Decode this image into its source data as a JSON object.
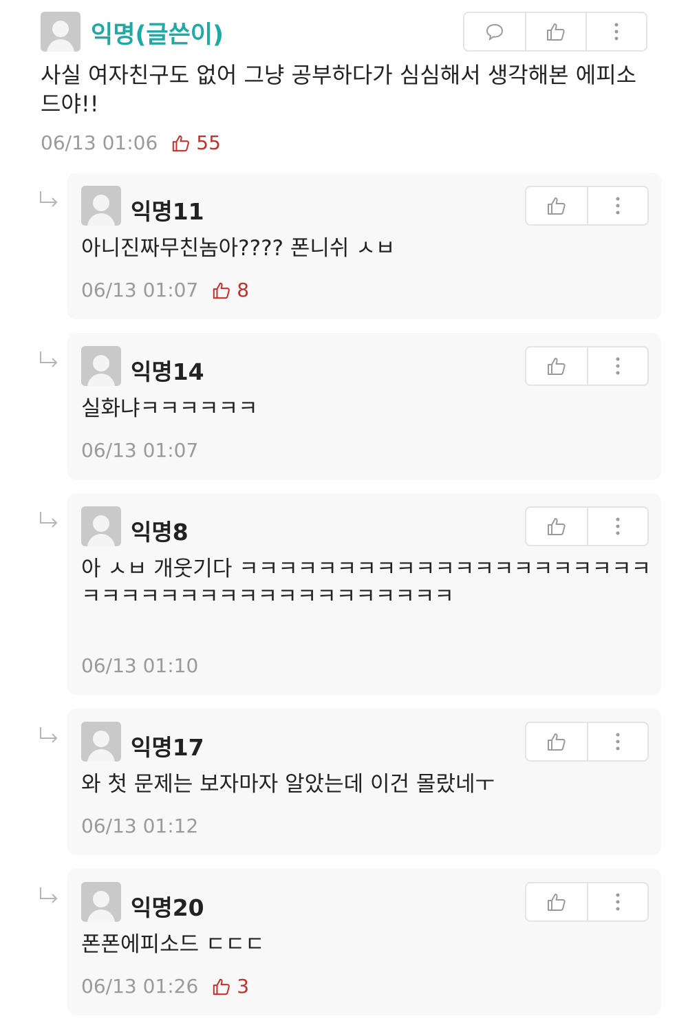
{
  "root": {
    "author": "익명(글쓴이)",
    "text": "사실 여자친구도 없어 그냥 공부하다가 심심해서 생각해본 에피소드야!!",
    "timestamp": "06/13 01:06",
    "votes": "55",
    "icons": [
      "comment-icon",
      "thumbs-up-icon",
      "more-vertical-icon"
    ]
  },
  "replies": [
    {
      "author": "익명11",
      "text": "아니진짜무친놈아???? 폰니쉬 ㅅㅂ",
      "timestamp": "06/13 01:07",
      "votes": "8"
    },
    {
      "author": "익명14",
      "text": "실화냐ㅋㅋㅋㅋㅋㅋ",
      "timestamp": "06/13 01:07",
      "votes": ""
    },
    {
      "author": "익명8",
      "text": "아 ㅅㅂ 개웃기다 ㅋㅋㅋㅋㅋㅋㅋㅋㅋㅋㅋㅋㅋㅋㅋㅋㅋㅋㅋㅋㅋㅋㅋㅋㅋㅋㅋㅋㅋㅋㅋㅋㅋㅋㅋㅋㅋㅋㅋㅋ",
      "timestamp": "06/13 01:10",
      "votes": ""
    },
    {
      "author": "익명17",
      "text": "와 첫 문제는 보자마자 알았는데 이건 몰랐네ㅜ",
      "timestamp": "06/13 01:12",
      "votes": ""
    },
    {
      "author": "익명20",
      "text": "폰폰에피소드 ㄷㄷㄷ",
      "timestamp": "06/13 01:26",
      "votes": "3"
    }
  ],
  "colors": {
    "author_accent": "#1fa9a5",
    "vote_red": "#c5302c",
    "meta_gray": "#9a9a9a",
    "reply_bg": "#f8f8f8"
  }
}
